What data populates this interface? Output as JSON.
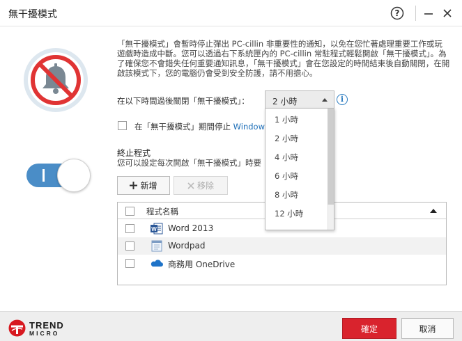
{
  "window": {
    "title": "無干擾模式",
    "help_label": "?",
    "close_label": "✕"
  },
  "description": "「無干擾模式」會暫時停止彈出 PC-cillin 非重要性的通知，以免在您忙著處理重要工作或玩遊戲時造成中斷。您可以透過右下系統匣內的 PC-cillin 常駐程式輕鬆開啟「無干擾模式」。為了確保您不會錯失任何重要通知訊息，「無干擾模式」會在您設定的時間結束後自動關閉，在開啟該模式下，您的電腦仍會受到安全防護，請不用擔心。",
  "toggle": {
    "state": "on",
    "color": "#4a8dc7"
  },
  "duration": {
    "label": "在以下時間過後關閉「無干擾模式」：",
    "selected": "2 小時",
    "options": [
      "1 小時",
      "2 小時",
      "4 小時",
      "6 小時",
      "8 小時",
      "12 小時"
    ]
  },
  "windows_update": {
    "text": "在「無干擾模式」期間停止 ",
    "link": "Windows"
  },
  "terminate": {
    "title": "終止程式",
    "subtitle": "您可以設定每次開啟「無干擾模式」時要",
    "add_label": "新增",
    "remove_label": "移除",
    "column_header": "程式名稱",
    "programs": [
      {
        "name": "Word 2013",
        "icon": "word-icon"
      },
      {
        "name": "Wordpad",
        "icon": "wordpad-icon"
      },
      {
        "name": "商務用 OneDrive",
        "icon": "onedrive-icon"
      }
    ]
  },
  "footer": {
    "brand_line1": "TREND",
    "brand_line2": "MICRO",
    "ok_label": "確定",
    "cancel_label": "取消"
  },
  "colors": {
    "accent": "#4a8dc7",
    "primary_button": "#d9232d",
    "link": "#1e6fb8"
  }
}
